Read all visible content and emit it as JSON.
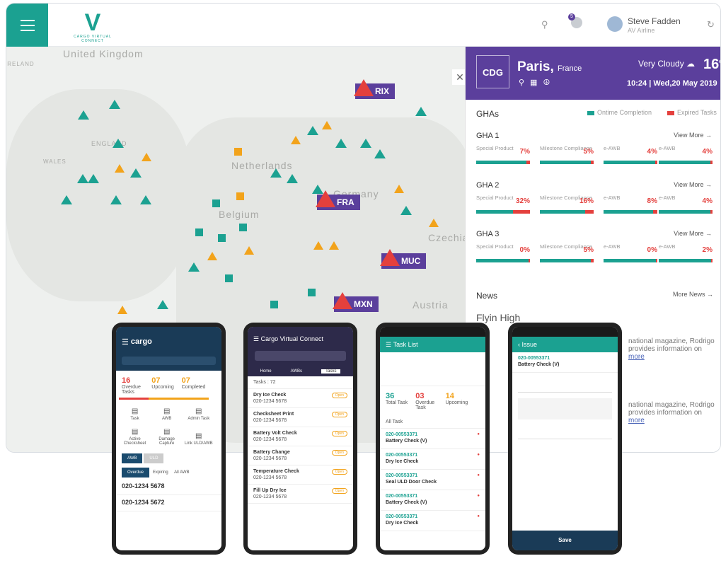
{
  "header": {
    "logo_text": "CARGO VIRTUAL CONNECT",
    "user_name": "Steve Fadden",
    "user_role": "AV Airline",
    "notif_count": "5"
  },
  "map": {
    "countries": [
      "United Kingdom",
      "IRELAND",
      "ENGLAND",
      "WALES",
      "Netherlands",
      "Belgium",
      "Germany",
      "Czechia",
      "Austria"
    ],
    "airports": [
      "RIX",
      "FRA",
      "MUC",
      "MXN"
    ]
  },
  "station": {
    "code": "CDG",
    "city": "Paris",
    "country": "France",
    "weather": "Very Cloudy",
    "temp": "16",
    "time": "10:24",
    "date": "Wed,20 May 2019"
  },
  "ghas": {
    "title": "GHAs",
    "legend": [
      "Ontime Completion",
      "Expired Tasks"
    ],
    "more": "View More",
    "items": [
      {
        "name": "GHA 1",
        "metrics": [
          {
            "label": "Special Product",
            "pct": "7%",
            "exp": 7
          },
          {
            "label": "Milestone Compliance",
            "pct": "5%",
            "exp": 5
          },
          {
            "label": "e-AWB",
            "pct": "4%",
            "exp": 4
          },
          {
            "label": "e-AWB",
            "pct": "4%",
            "exp": 4
          }
        ]
      },
      {
        "name": "GHA 2",
        "metrics": [
          {
            "label": "Special Product",
            "pct": "32%",
            "exp": 32
          },
          {
            "label": "Milestone Compliance",
            "pct": "16%",
            "exp": 16
          },
          {
            "label": "e-AWB",
            "pct": "8%",
            "exp": 8
          },
          {
            "label": "e-AWB",
            "pct": "4%",
            "exp": 4
          }
        ]
      },
      {
        "name": "GHA 3",
        "metrics": [
          {
            "label": "Special Product",
            "pct": "0%",
            "exp": 0
          },
          {
            "label": "Milestone Compliance",
            "pct": "5%",
            "exp": 5
          },
          {
            "label": "e-AWB",
            "pct": "0%",
            "exp": 0
          },
          {
            "label": "e-AWB",
            "pct": "2%",
            "exp": 2
          }
        ]
      }
    ]
  },
  "news": {
    "title": "News",
    "more": "More News",
    "headline": "Flyin High",
    "snippet_a": "national magazine, Rodrigo",
    "snippet_b": "provides information on",
    "link": "more"
  },
  "phone1": {
    "brand": "cargo",
    "counts": [
      {
        "n": "16",
        "l": "Overdue Tasks"
      },
      {
        "n": "07",
        "l": "Upcoming"
      },
      {
        "n": "07",
        "l": "Completed"
      }
    ],
    "tiles": [
      "Task",
      "AWB",
      "Admin Task",
      "Active Checksheet",
      "Damage Capture",
      "Link ULD/AWB"
    ],
    "tabs": [
      "AWB",
      "ULD"
    ],
    "subtabs": [
      "Overdue",
      "Expiring",
      "All AWB"
    ],
    "awbs": [
      "020-1234 5678",
      "020-1234 5672"
    ]
  },
  "phone2": {
    "title": "Cargo Virtual Connect",
    "tabs": [
      "Home",
      "AWBs",
      "Tasks"
    ],
    "count_label": "Tasks : 72",
    "tasks": [
      "Dry Ice Check",
      "Checksheet Print",
      "Battery Volt Check",
      "Battery Change",
      "Temperature Check",
      "Fill Up Dry Ice"
    ],
    "ref": "020-1234 5678"
  },
  "phone3": {
    "title": "Task List",
    "counts": [
      {
        "n": "36",
        "l": "Total Task"
      },
      {
        "n": "03",
        "l": "Overdue Task"
      },
      {
        "n": "14",
        "l": "Upcoming"
      }
    ],
    "all": "All Task",
    "tasks": [
      {
        "awb": "020-00553371",
        "name": "Battery Check (V)"
      },
      {
        "awb": "020-00553371",
        "name": "Dry Ice Check"
      },
      {
        "awb": "020-00553371",
        "name": "Seal ULD Door Check"
      },
      {
        "awb": "020-00553371",
        "name": "Battery Check (V)"
      },
      {
        "awb": "020-00553371",
        "name": "Dry Ice Check"
      }
    ]
  },
  "phone4": {
    "title": "Issue",
    "awb": "020-00553371",
    "name": "Battery Check (V)",
    "btn": "Save"
  }
}
